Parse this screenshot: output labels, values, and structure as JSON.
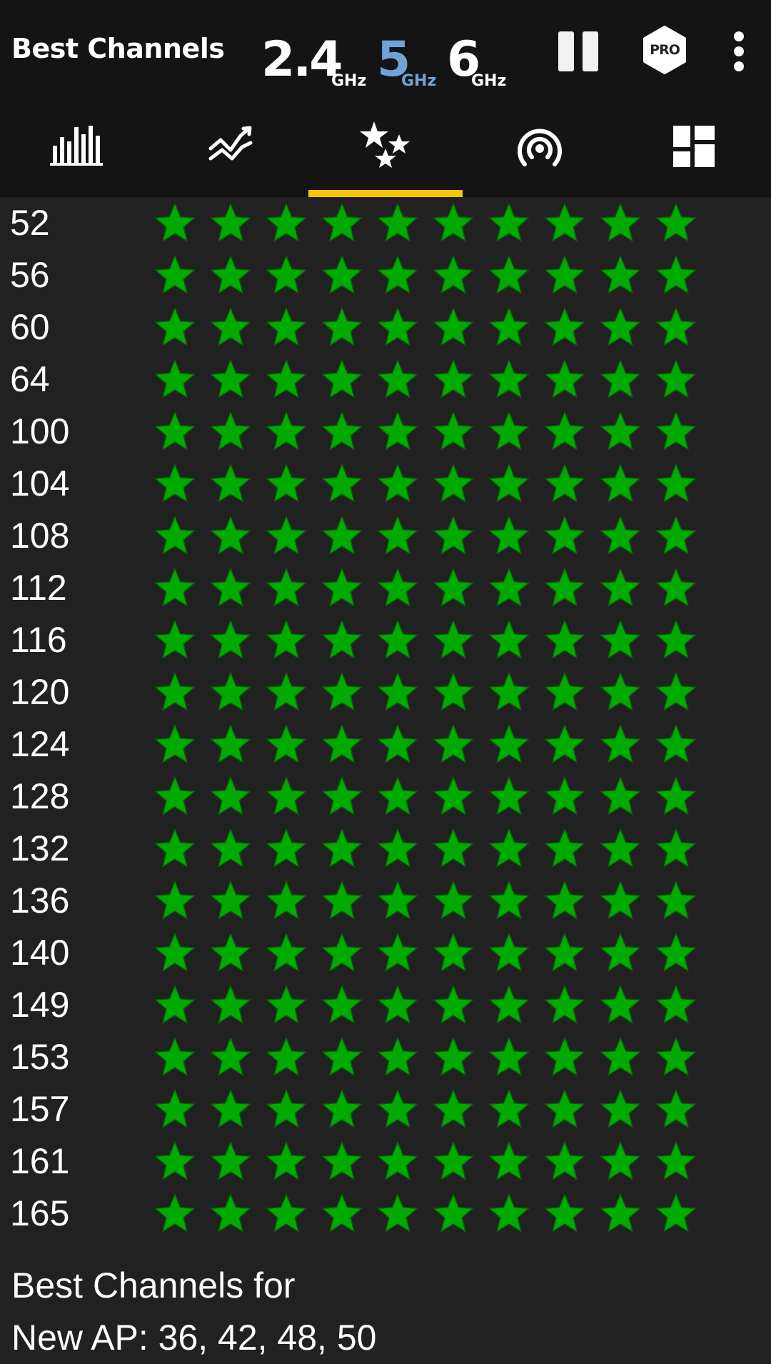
{
  "header": {
    "title": "Best Channels",
    "bands": [
      {
        "value": "2.4",
        "unit": "GHz",
        "selected": false
      },
      {
        "value": "5",
        "unit": "GHz",
        "selected": true
      },
      {
        "value": "6",
        "unit": "GHz",
        "selected": false
      }
    ],
    "pro_label": "PRO",
    "pause_icon": "pause-icon",
    "menu_icon": "more-vert-icon"
  },
  "tabs": [
    {
      "icon": "bar-graph-icon",
      "selected": false
    },
    {
      "icon": "time-graph-icon",
      "selected": false
    },
    {
      "icon": "stars-icon",
      "selected": true
    },
    {
      "icon": "access-point-icon",
      "selected": false
    },
    {
      "icon": "dashboard-icon",
      "selected": false
    }
  ],
  "channels": [
    {
      "channel": "52",
      "rating": 10
    },
    {
      "channel": "56",
      "rating": 10
    },
    {
      "channel": "60",
      "rating": 10
    },
    {
      "channel": "64",
      "rating": 10
    },
    {
      "channel": "100",
      "rating": 10
    },
    {
      "channel": "104",
      "rating": 10
    },
    {
      "channel": "108",
      "rating": 10
    },
    {
      "channel": "112",
      "rating": 10
    },
    {
      "channel": "116",
      "rating": 10
    },
    {
      "channel": "120",
      "rating": 10
    },
    {
      "channel": "124",
      "rating": 10
    },
    {
      "channel": "128",
      "rating": 10
    },
    {
      "channel": "132",
      "rating": 10
    },
    {
      "channel": "136",
      "rating": 10
    },
    {
      "channel": "140",
      "rating": 10
    },
    {
      "channel": "149",
      "rating": 10
    },
    {
      "channel": "153",
      "rating": 10
    },
    {
      "channel": "157",
      "rating": 10
    },
    {
      "channel": "161",
      "rating": 10
    },
    {
      "channel": "165",
      "rating": 10
    }
  ],
  "max_rating": 10,
  "footer": {
    "line1": "Best Channels for",
    "line2": "New AP: 36, 42, 48, 50"
  },
  "colors": {
    "background": "#212121",
    "toolbar": "#141414",
    "star_fill": "#00aa00",
    "star_stroke": "#0a5a0a",
    "selected_band": "#6fa3d8",
    "tab_indicator": "#f8c30b"
  }
}
